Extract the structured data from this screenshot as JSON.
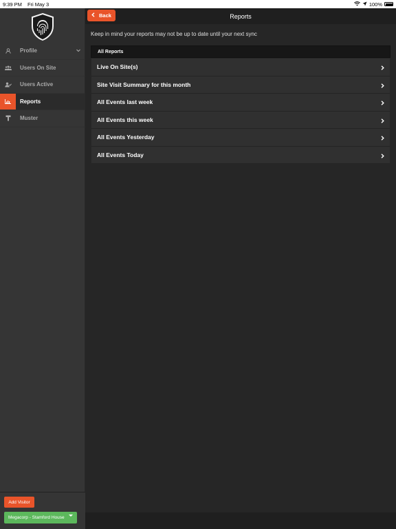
{
  "status_bar": {
    "time": "9:39 PM",
    "date": "Fri May 3",
    "battery": "100%"
  },
  "sidebar": {
    "items": [
      {
        "label": "Profile",
        "icon": "user-icon"
      },
      {
        "label": "Users On Site",
        "icon": "users-group-icon"
      },
      {
        "label": "Users Active",
        "icon": "user-check-icon"
      },
      {
        "label": "Reports",
        "icon": "chart-icon"
      },
      {
        "label": "Muster",
        "icon": "muster-icon"
      }
    ],
    "add_visitor_label": "Add Visitor",
    "location_label": "Megacorp - Stamford House"
  },
  "header": {
    "back_label": "Back",
    "title": "Reports"
  },
  "notice": "Keep in mind your reports may not be up to date until your next sync",
  "section_title": "All Reports",
  "reports": [
    "Live On Site(s)",
    "Site Visit Summary for this month",
    "All Events last week",
    "All Events this week",
    "All Events Yesterday",
    "All Events Today"
  ],
  "colors": {
    "accent": "#e9542a",
    "location": "#5cb85c",
    "sidebar": "#353535",
    "main": "#262626"
  }
}
